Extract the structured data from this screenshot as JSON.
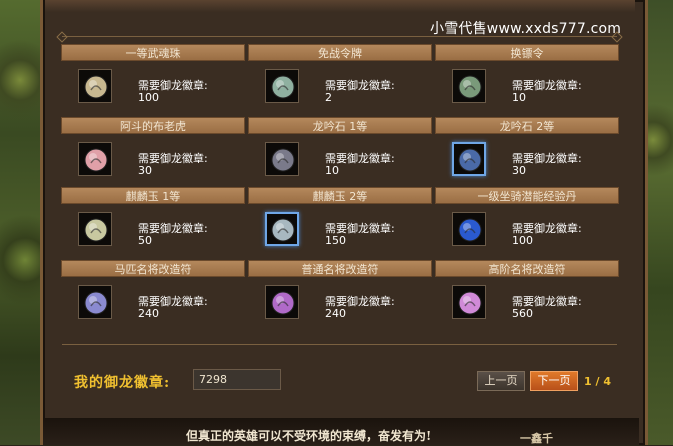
{
  "watermark": "小雪代售www.xxds777.com",
  "cost_label": "需要御龙徽章:",
  "items": [
    {
      "name": "一等武魂珠",
      "cost": "100",
      "icon": "soul-orb-icon",
      "color": "#c8b890",
      "selected": false
    },
    {
      "name": "免战令牌",
      "cost": "2",
      "icon": "truce-token-icon",
      "color": "#8fb0a0",
      "selected": false
    },
    {
      "name": "换镖令",
      "cost": "10",
      "icon": "escort-token-icon",
      "color": "#7a9a7a",
      "selected": false
    },
    {
      "name": "阿斗的布老虎",
      "cost": "30",
      "icon": "cloth-tiger-icon",
      "color": "#e0a0a8",
      "selected": false
    },
    {
      "name": "龙吟石 1等",
      "cost": "10",
      "icon": "dragon-stone-icon",
      "color": "#7a7a8a",
      "selected": false
    },
    {
      "name": "龙吟石 2等",
      "cost": "30",
      "icon": "dragon-stone-blue-icon",
      "color": "#4a6aa8",
      "selected": true
    },
    {
      "name": "麒麟玉 1等",
      "cost": "50",
      "icon": "qilin-jade-icon",
      "color": "#c8c8a0",
      "selected": false
    },
    {
      "name": "麒麟玉 2等",
      "cost": "150",
      "icon": "qilin-jade-blue-icon",
      "color": "#a8b8c0",
      "selected": true
    },
    {
      "name": "一级坐骑潜能经验丹",
      "cost": "100",
      "icon": "mount-exp-pill-icon",
      "color": "#2a5ad0",
      "selected": false
    },
    {
      "name": "马匹名将改造符",
      "cost": "240",
      "icon": "horse-talisman-icon",
      "color": "#8a8ad0",
      "selected": false
    },
    {
      "name": "普通名将改造符",
      "cost": "240",
      "icon": "general-talisman-icon",
      "color": "#b06ac8",
      "selected": false
    },
    {
      "name": "高阶名将改造符",
      "cost": "560",
      "icon": "advanced-talisman-icon",
      "color": "#d08ad8",
      "selected": false
    }
  ],
  "footer": {
    "badge_label": "我的御龙徽章:",
    "badge_value": "7298",
    "prev_label": "上一页",
    "next_label": "下一页",
    "page_info": "1 / 4",
    "slogan": "但真正的英雄可以不受环境的束缚，奋发有为!",
    "signature": "一鑫千"
  }
}
